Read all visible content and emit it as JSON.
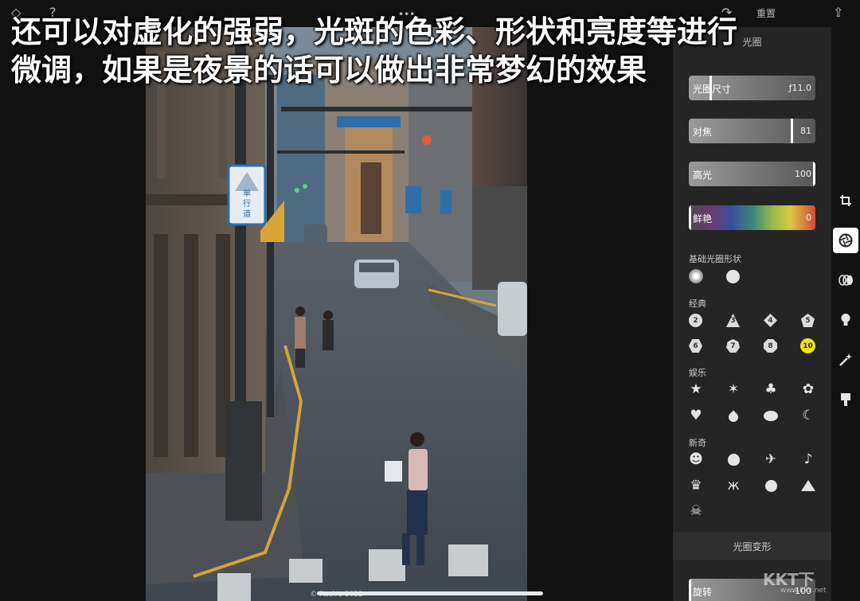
{
  "caption": {
    "line1": "还可以对虚化的强弱，光斑的色彩、形状和亮度等进行",
    "line2": "微调，如果是夜景的话可以做出非常梦幻的效果"
  },
  "topbar": {
    "reset_label": "重置",
    "left_icon_1": "◇",
    "left_icon_2": "?",
    "more_icon": "•••",
    "redo_icon": "↷",
    "share_icon": "⇪"
  },
  "photo": {
    "watermark": "© Rack's 2022",
    "sign_one_way": "单\n行\n道"
  },
  "panel": {
    "title": "光圈",
    "sliders": [
      {
        "label": "光圈尺寸",
        "value": "ƒ11.0",
        "level": 0.17
      },
      {
        "label": "对焦",
        "value": "81",
        "level": 0.81
      },
      {
        "label": "高光",
        "value": "100",
        "level": 1.0
      },
      {
        "label": "鲜艳",
        "value": "0",
        "level": 0.0
      }
    ],
    "basic_shapes_label": "基础光圈形状",
    "classic_label": "经典",
    "classic_items": [
      "2",
      "3",
      "4",
      "5",
      "6",
      "7",
      "8",
      "10"
    ],
    "classic_selected": "10",
    "entertainment_label": "娱乐",
    "novelty_label": "新奇",
    "transform_label": "光圈变形",
    "rotation": {
      "label": "旋转",
      "value": "-100",
      "level": 0.0
    }
  },
  "tools": [
    "crop-icon",
    "aperture-icon",
    "lens-blur-icon",
    "lightbulb-icon",
    "magic-wand-icon",
    "paint-brush-icon"
  ],
  "brand_watermark": {
    "logo": "KKT下",
    "site": "www.kkx.net"
  },
  "colors": {
    "accent_yellow": "#f1e21a",
    "panel_bg": "#252525",
    "background": "#121212"
  }
}
